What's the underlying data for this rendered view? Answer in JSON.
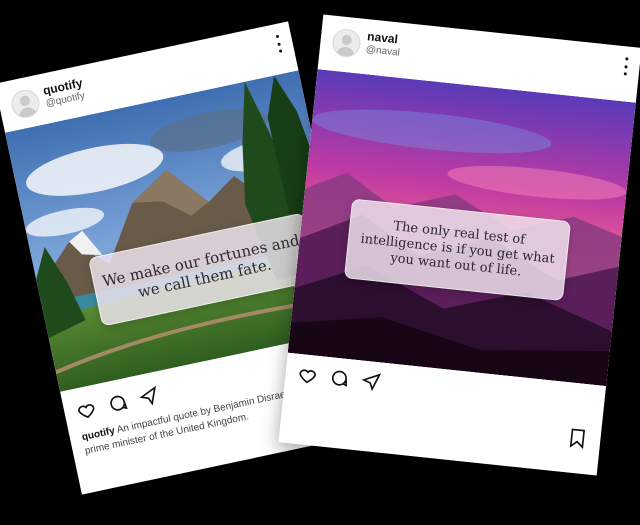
{
  "posts": [
    {
      "username": "quotify",
      "handle": "@quotify",
      "quote": "We make our fortunes and we call them fate.",
      "caption_user": "quotify",
      "caption_text": "An impactful quote by Benjamin Disraeli, a former prime minister of the United Kingdom."
    },
    {
      "username": "naval",
      "handle": "@naval",
      "quote": "The only real test of intelligence is if you get what you want out of life."
    }
  ]
}
